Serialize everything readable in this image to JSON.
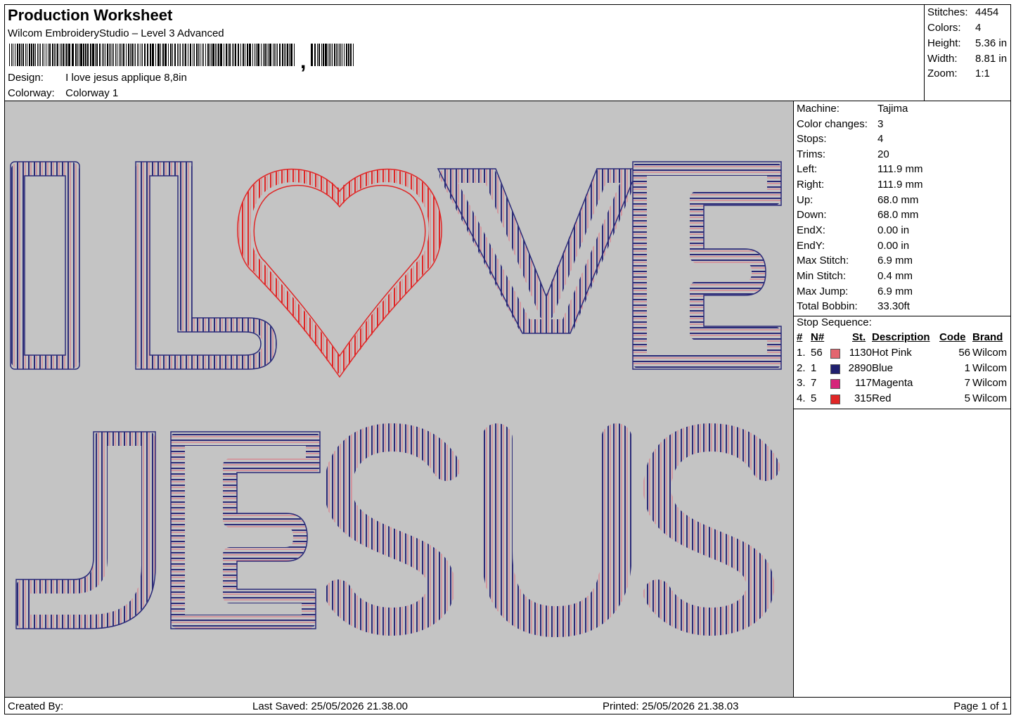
{
  "header": {
    "title": "Production Worksheet",
    "software": "Wilcom EmbroideryStudio – Level 3 Advanced",
    "barcode_glyph": ",",
    "design_label": "Design:",
    "design_value": "I love jesus applique 8,8in",
    "colorway_label": "Colorway:",
    "colorway_value": "Colorway 1"
  },
  "stats": [
    {
      "label": "Stitches:",
      "value": "4454"
    },
    {
      "label": "Colors:",
      "value": "4"
    },
    {
      "label": "Height:",
      "value": "5.36 in"
    },
    {
      "label": "Width:",
      "value": "8.81 in"
    },
    {
      "label": "Zoom:",
      "value": "1:1"
    }
  ],
  "machine_info": [
    {
      "label": "Machine:",
      "value": "Tajima"
    },
    {
      "label": "Color changes:",
      "value": "3"
    },
    {
      "label": "Stops:",
      "value": "4"
    },
    {
      "label": "Trims:",
      "value": "20"
    },
    {
      "label": "Left:",
      "value": "111.9 mm"
    },
    {
      "label": "Right:",
      "value": "111.9 mm"
    },
    {
      "label": "Up:",
      "value": "68.0 mm"
    },
    {
      "label": "Down:",
      "value": "68.0 mm"
    },
    {
      "label": "EndX:",
      "value": "0.00 in"
    },
    {
      "label": "EndY:",
      "value": "0.00 in"
    },
    {
      "label": "Max Stitch:",
      "value": "6.9 mm"
    },
    {
      "label": "Min Stitch:",
      "value": "0.4 mm"
    },
    {
      "label": "Max Jump:",
      "value": "6.9 mm"
    },
    {
      "label": "Total Bobbin:",
      "value": "33.30ft"
    }
  ],
  "stop_sequence": {
    "title": "Stop Sequence:",
    "columns": {
      "num": "#",
      "n": "N#",
      "st": "St.",
      "description": "Description",
      "code": "Code",
      "brand": "Brand"
    },
    "rows": [
      {
        "num": "1.",
        "n": "56",
        "color": "#e3666f",
        "st": "1130",
        "description": "Hot Pink",
        "code": "56",
        "brand": "Wilcom"
      },
      {
        "num": "2.",
        "n": "1",
        "color": "#1f1f6e",
        "st": "2890",
        "description": "Blue",
        "code": "1",
        "brand": "Wilcom"
      },
      {
        "num": "3.",
        "n": "7",
        "color": "#d6247a",
        "st": "117",
        "description": "Magenta",
        "code": "7",
        "brand": "Wilcom"
      },
      {
        "num": "4.",
        "n": "5",
        "color": "#e02626",
        "st": "315",
        "description": "Red",
        "code": "5",
        "brand": "Wilcom"
      }
    ]
  },
  "design_text": {
    "line1_left": "I L",
    "line1_right": "VE",
    "line2": "JESUS"
  },
  "colors": {
    "outline": "#2a2a78",
    "stitch_pink": "#e06a78",
    "heart": "#e02626",
    "background": "#c4c4c4"
  },
  "footer": {
    "created_by": "Created By:",
    "last_saved": "Last Saved: 25/05/2026 21.38.00",
    "printed": "Printed: 25/05/2026 21.38.03",
    "page": "Page 1 of 1"
  }
}
